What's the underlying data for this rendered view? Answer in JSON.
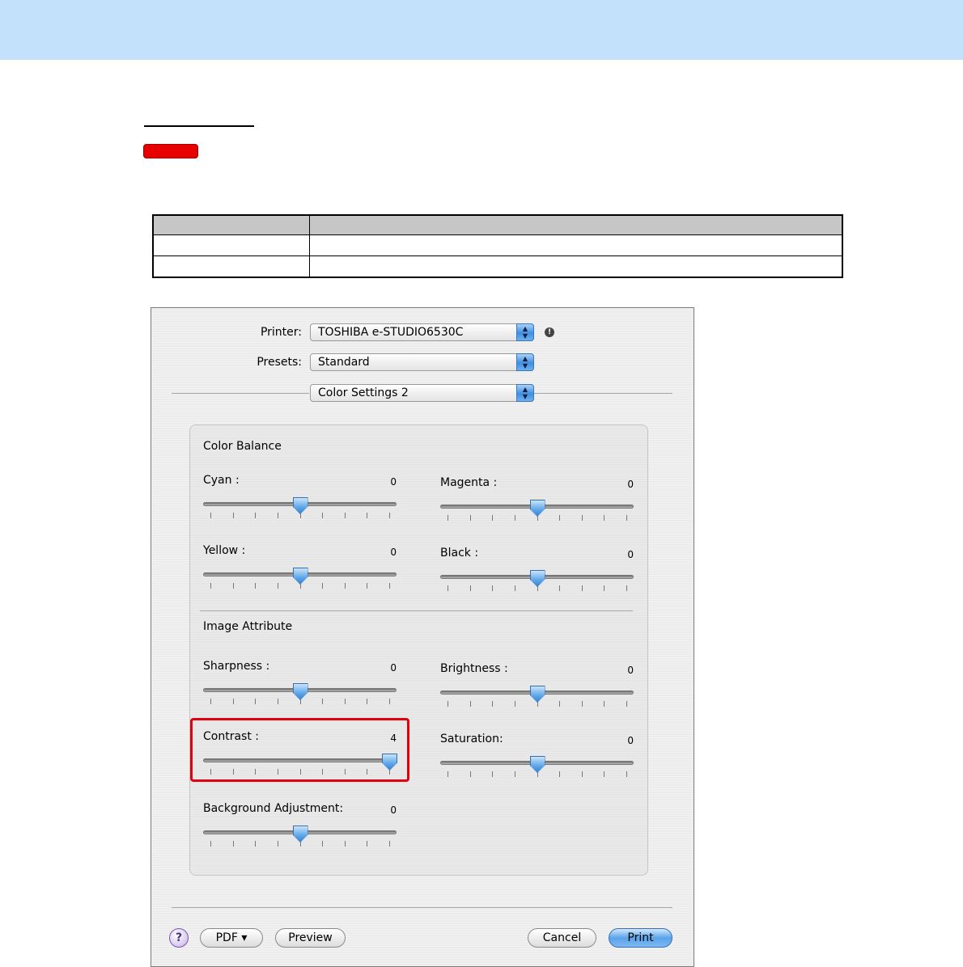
{
  "dialog": {
    "printer": {
      "label": "Printer:",
      "value": "TOSHIBA e-STUDIO6530C"
    },
    "presets": {
      "label": "Presets:",
      "value": "Standard"
    },
    "panel": {
      "value": "Color Settings 2"
    },
    "color_balance": {
      "title": "Color Balance",
      "sliders": [
        {
          "label": "Cyan :",
          "value": "0",
          "position": 0.5
        },
        {
          "label": "Magenta :",
          "value": "0",
          "position": 0.5
        },
        {
          "label": "Yellow :",
          "value": "0",
          "position": 0.5
        },
        {
          "label": "Black :",
          "value": "0",
          "position": 0.5
        }
      ]
    },
    "image_attribute": {
      "title": "Image Attribute",
      "sliders": [
        {
          "label": "Sharpness :",
          "value": "0",
          "position": 0.5
        },
        {
          "label": "Brightness :",
          "value": "0",
          "position": 0.5
        },
        {
          "label": "Contrast :",
          "value": "4",
          "position": 1.0
        },
        {
          "label": "Saturation:",
          "value": "0",
          "position": 0.5
        },
        {
          "label": "Background Adjustment:",
          "value": "0",
          "position": 0.5
        }
      ]
    },
    "buttons": {
      "help": "?",
      "pdf": "PDF ▾",
      "preview": "Preview",
      "cancel": "Cancel",
      "print": "Print"
    }
  },
  "colors": {
    "header_band": "#c3e1fb",
    "highlight": "#e2000f",
    "accent_blue": "#5aa3ea",
    "red_tag": "#e60000"
  },
  "icons": {
    "popup_arrows": "updown-arrows-icon",
    "warning": "exclamation-icon",
    "help": "question-mark-icon"
  }
}
